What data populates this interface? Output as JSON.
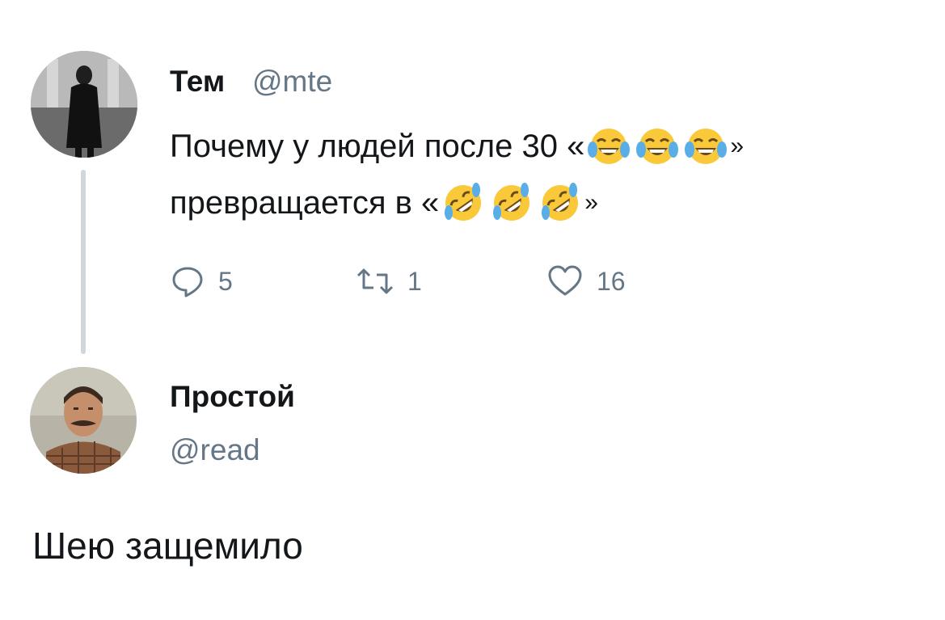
{
  "tweet": {
    "author_name": "Тем",
    "author_handle": "@mte",
    "text_line1_before": "Почему у людей после 30 «",
    "text_line1_after": "»",
    "text_line2_before": "превращается в «",
    "text_line2_after": "»",
    "emoji_group1": "face-with-tears-of-joy-icon",
    "emoji_group2": "rolling-on-the-floor-laughing-icon",
    "replies_count": "5",
    "retweets_count": "1",
    "likes_count": "16"
  },
  "reply": {
    "author_name": "Простой",
    "author_handle": "@read",
    "text": "Шею защемило"
  },
  "colors": {
    "text": "#14171a",
    "secondary": "#657786",
    "thread_line": "#cfd6dc",
    "emoji_yellow": "#f9c93a",
    "emoji_tear": "#5aaee8"
  }
}
